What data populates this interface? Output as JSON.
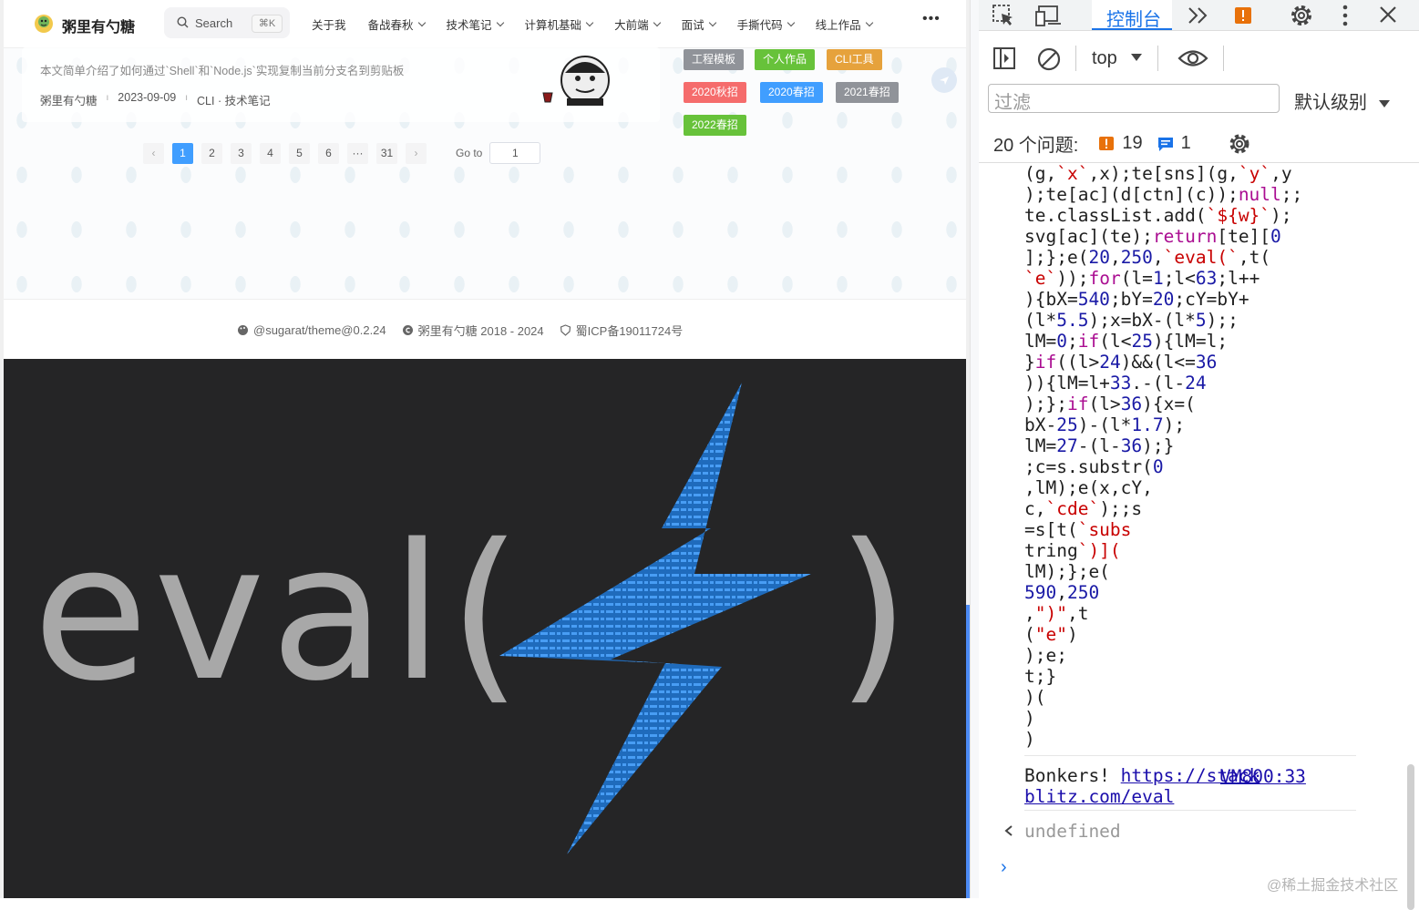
{
  "site": {
    "brand": "粥里有勺糖",
    "search_label": "Search",
    "search_shortcut": "⌘K",
    "nav": [
      {
        "label": "关于我",
        "has_dropdown": false
      },
      {
        "label": "备战春秋",
        "has_dropdown": true
      },
      {
        "label": "技术笔记",
        "has_dropdown": true
      },
      {
        "label": "计算机基础",
        "has_dropdown": true
      },
      {
        "label": "大前端",
        "has_dropdown": true
      },
      {
        "label": "面试",
        "has_dropdown": true
      },
      {
        "label": "手撕代码",
        "has_dropdown": true
      },
      {
        "label": "线上作品",
        "has_dropdown": true
      }
    ],
    "more_icon": "ellipsis-icon"
  },
  "article": {
    "description": "本文简单介绍了如何通过`Shell`和`Node.js`实现复制当前分支名到剪贴板",
    "author": "粥里有勺糖",
    "date": "2023-09-09",
    "tags_line": "CLI · 技术笔记"
  },
  "tags": [
    {
      "label": "工程模板",
      "color": "#909399"
    },
    {
      "label": "个人作品",
      "color": "#67c23a"
    },
    {
      "label": "CLI工具",
      "color": "#e6a23c"
    },
    {
      "label": "2020秋招",
      "color": "#f56c6c"
    },
    {
      "label": "2020春招",
      "color": "#409eff"
    },
    {
      "label": "2021春招",
      "color": "#909399"
    },
    {
      "label": "2022春招",
      "color": "#67c23a"
    }
  ],
  "pagination": {
    "prev": "‹",
    "pages": [
      "1",
      "2",
      "3",
      "4",
      "5",
      "6",
      "···",
      "31"
    ],
    "current": "1",
    "next": "›",
    "goto_label": "Go to",
    "goto_value": "1"
  },
  "footer": {
    "theme": "@sugarat/theme@0.2.24",
    "copyright": "粥里有勺糖 2018 - 2024",
    "icp": "蜀ICP备19011724号"
  },
  "hero": {
    "eval_text": "eval(",
    "close_paren": ")"
  },
  "devtools": {
    "active_tab": "控制台",
    "context": "top",
    "filter_placeholder": "过滤",
    "level": "默认级别",
    "issues_label": "20 个问题:",
    "warning_count": "19",
    "info_count": "1",
    "code_lines": [
      "(g,`x`,x);te[sns](g,`y`,y",
      ");te[ac](d[ctn](c));null;;",
      "te.classList.add(`${w}`);",
      "svg[ac](te);return[te][0",
      "];};e(20,250,`eval(`,t(",
      "`e`));for(l=1;l<63;l++",
      "){bX=540;bY=20;cY=bY+",
      "(l*5.5);x=bX-(l*5);;",
      "lM=0;if(l<25){lM=l;",
      "}if((l>24)&&(l<=36",
      ")){lM=l+33.-(l-24",
      ");};if(l>36){x=(",
      "bX-25)-(l*1.7);",
      "lM=27-(l-36);}",
      ";c=s.substr(0",
      ",lM);e(x,cY,",
      "c,`cde`);;s",
      "=s[t(`subs",
      "tring`)](",
      "lM);};e(",
      "590,250",
      ",\")\",t",
      "(\"e\")",
      ");e;",
      "t;}",
      ")(",
      ")",
      ")"
    ],
    "log_text": "Bonkers!",
    "log_link_1": "https://stack",
    "log_link_2": "blitz.com/eval",
    "log_source": "VM800:33",
    "return_value": "undefined",
    "prompt": "›"
  },
  "watermark": "@稀土掘金技术社区"
}
